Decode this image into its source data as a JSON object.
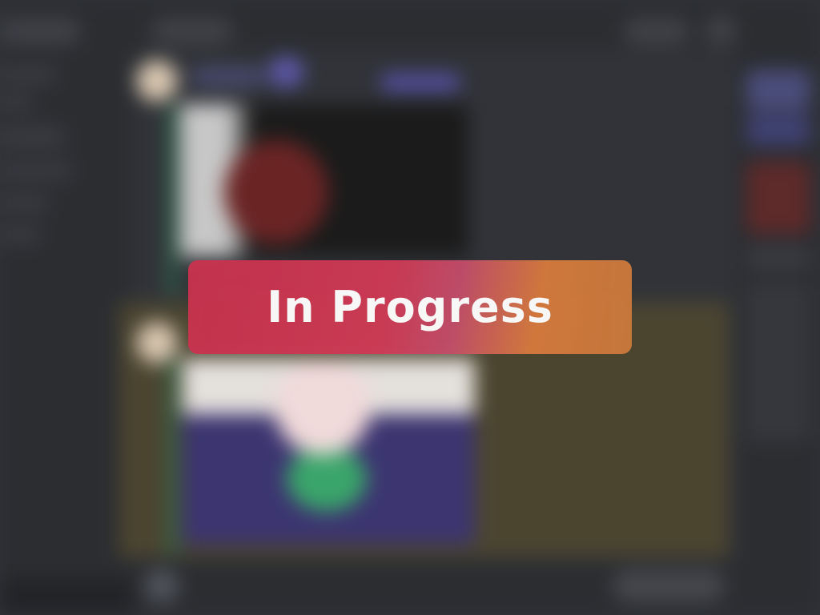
{
  "overlay": {
    "status_label": "In Progress",
    "gradient_start": "#c8324d",
    "gradient_end": "#c9793b",
    "text_color": "#ffffff"
  },
  "background": {
    "theme_bg": "#313338",
    "sidebar_bg": "#2b2d31",
    "highlight_bg": "#4b4530",
    "accent_green": "#2f6b4e",
    "accent_purple": "#5b57a6"
  }
}
